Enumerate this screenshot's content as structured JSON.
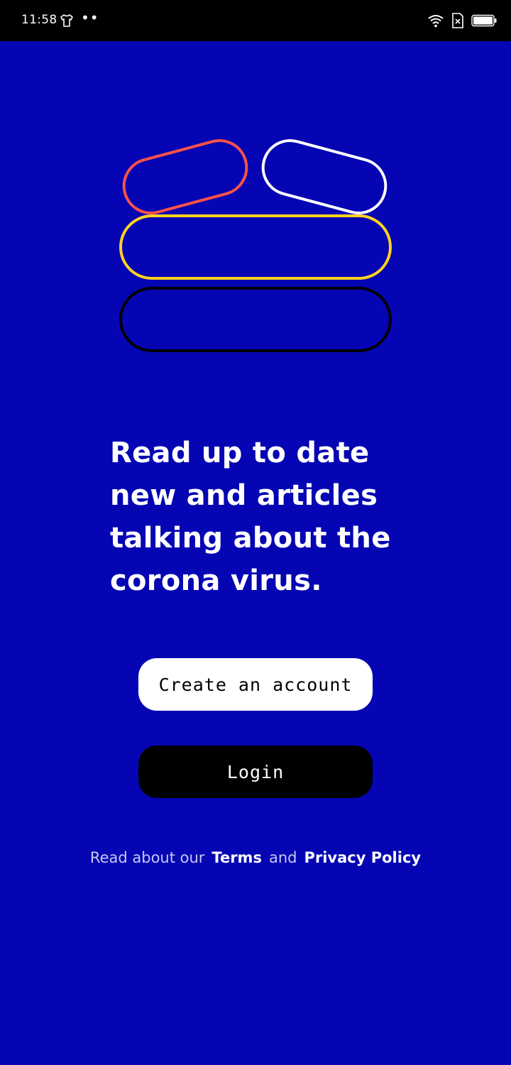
{
  "status_bar": {
    "time": "11:58",
    "dots": "••",
    "left_icons": [
      "shirt-icon"
    ],
    "right_icons": [
      "wifi-icon",
      "sim-x-icon",
      "battery-icon"
    ]
  },
  "hero": {
    "pill_colors": {
      "top_left": "#ff5247",
      "top_right": "#ffffff",
      "middle": "#ffd21f",
      "bottom": "#000000"
    }
  },
  "headline": "Read up to date new and articles talking about the corona virus.",
  "buttons": {
    "create_account": "Create an account",
    "login": "Login"
  },
  "legal": {
    "prefix": "Read about our",
    "terms": "Terms",
    "and": "and",
    "privacy": "Privacy Policy"
  },
  "colors": {
    "background": "#0505b3",
    "status_bar": "#000000"
  }
}
